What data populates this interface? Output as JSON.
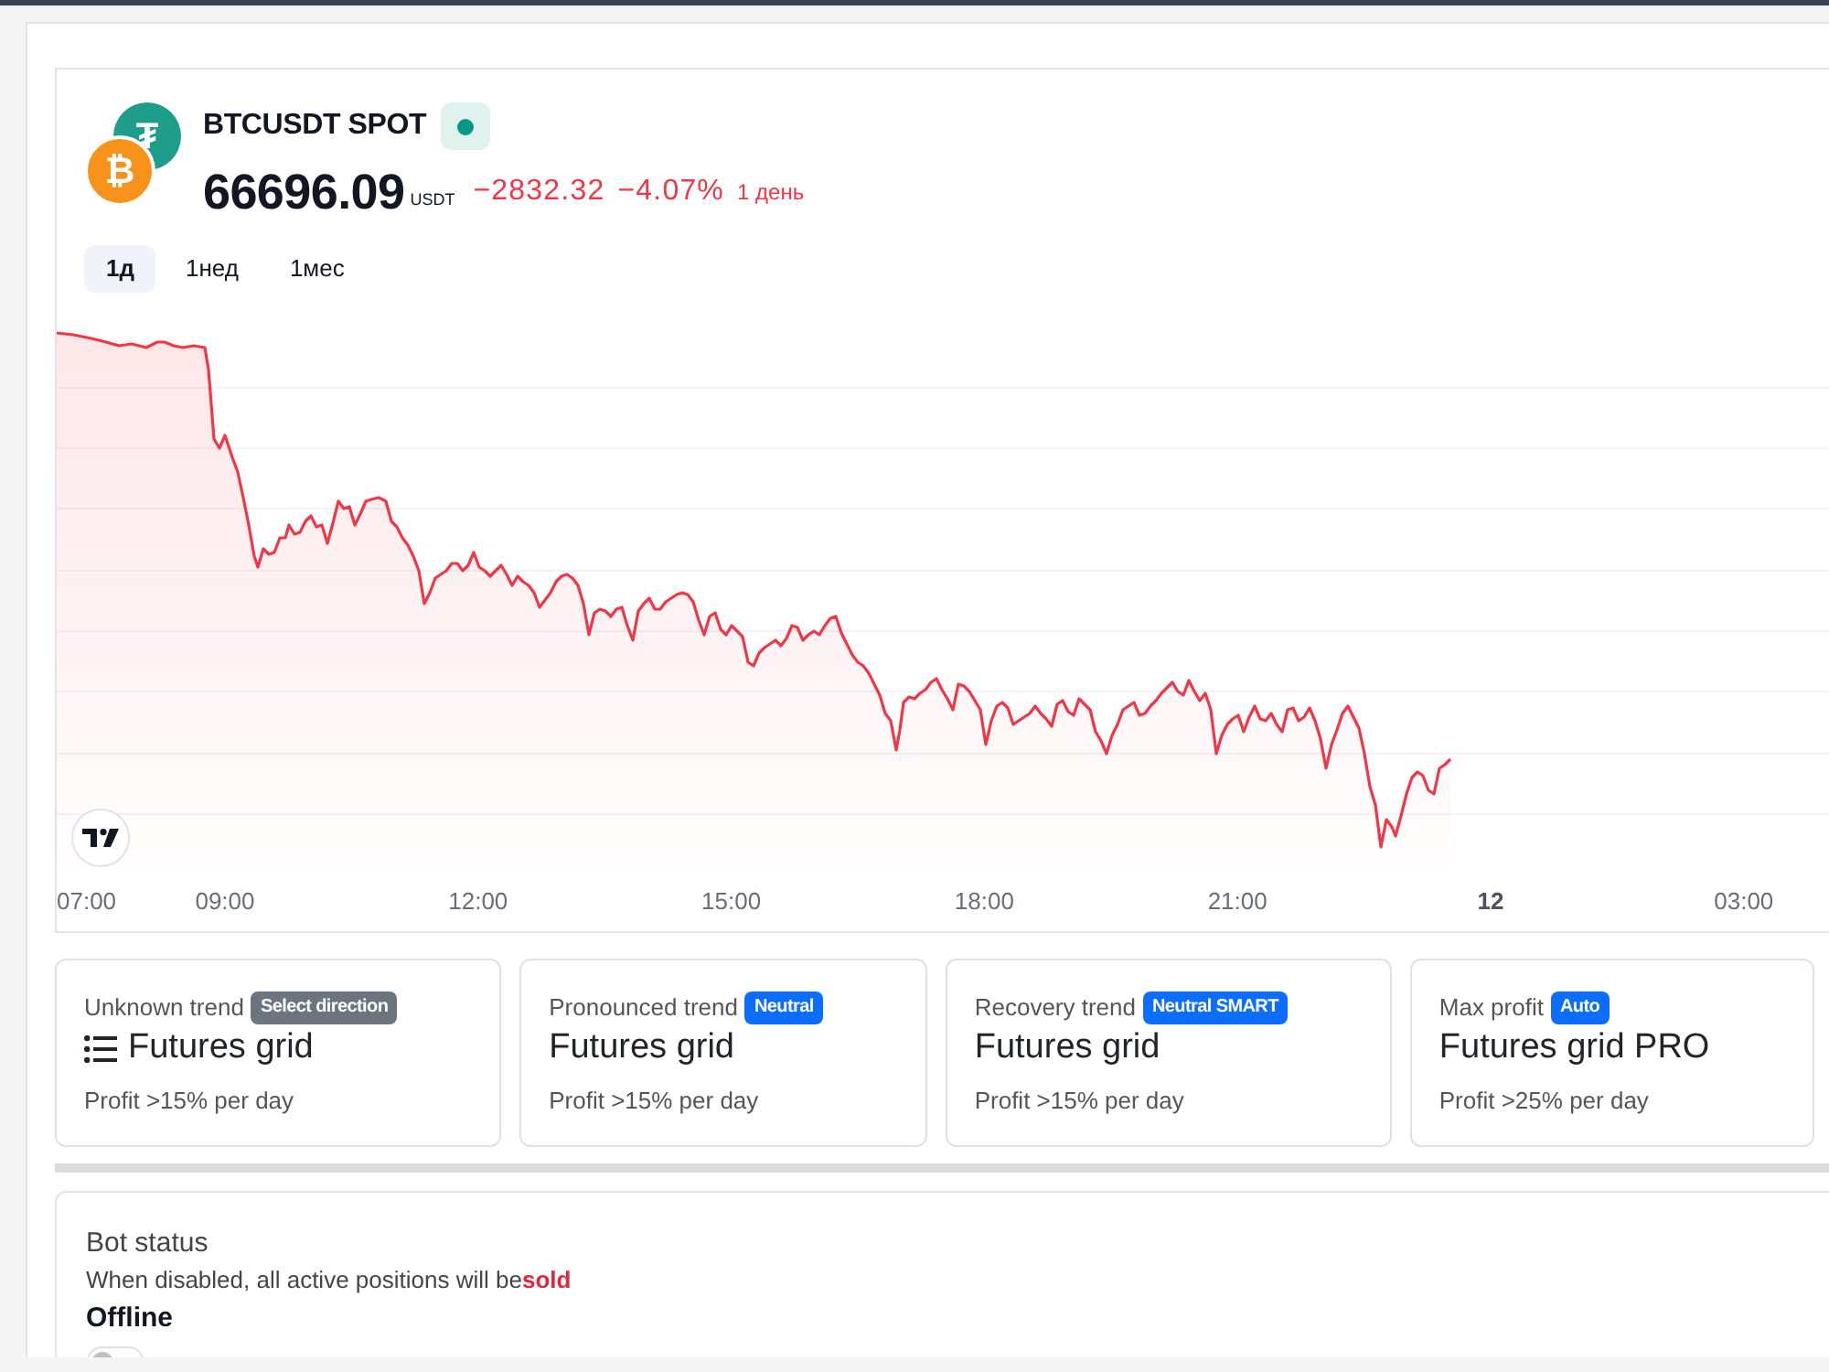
{
  "symbol": {
    "title": "BTCUSDT SPOT",
    "base_glyph": "₿",
    "quote_glyph": "₮",
    "live": true
  },
  "price": {
    "value": "66696.09",
    "unit": "USDT",
    "change": "−2832.32",
    "change_percent": "−4.07%",
    "period": "1 день",
    "falling": true
  },
  "periods": [
    {
      "label": "1д",
      "selected": true
    },
    {
      "label": "1нед",
      "selected": false
    },
    {
      "label": "1мес",
      "selected": false
    }
  ],
  "chart": {
    "time_axis": [
      {
        "label": "07:00",
        "kind": "time"
      },
      {
        "label": "09:00",
        "kind": "time"
      },
      {
        "label": "12:00",
        "kind": "time"
      },
      {
        "label": "15:00",
        "kind": "time"
      },
      {
        "label": "18:00",
        "kind": "time"
      },
      {
        "label": "21:00",
        "kind": "time"
      },
      {
        "label": "12",
        "kind": "day"
      },
      {
        "label": "03:00",
        "kind": "time"
      }
    ]
  },
  "strategies": [
    {
      "label": "Unknown trend",
      "badge": "Select direction",
      "color": "#6c757d",
      "list_icon": true,
      "title": "Futures grid",
      "profit": "Profit >15% per day"
    },
    {
      "label": "Pronounced trend",
      "badge": "Neutral",
      "color": "#0d6efd",
      "list_icon": false,
      "title": "Futures grid",
      "profit": "Profit >15% per day"
    },
    {
      "label": "Recovery trend",
      "badge": "Neutral SMART",
      "color": "#0d6efd",
      "list_icon": false,
      "title": "Futures grid",
      "profit": "Profit >15% per day"
    },
    {
      "label": "Max profit",
      "badge": "Auto",
      "color": "#0d6efd",
      "list_icon": false,
      "title": "Futures grid PRO",
      "profit": "Profit >25% per day"
    }
  ],
  "bot": {
    "title": "Bot status",
    "note": "When disabled, all active positions will be**sold**",
    "state": "Offline",
    "enabled": false
  }
}
